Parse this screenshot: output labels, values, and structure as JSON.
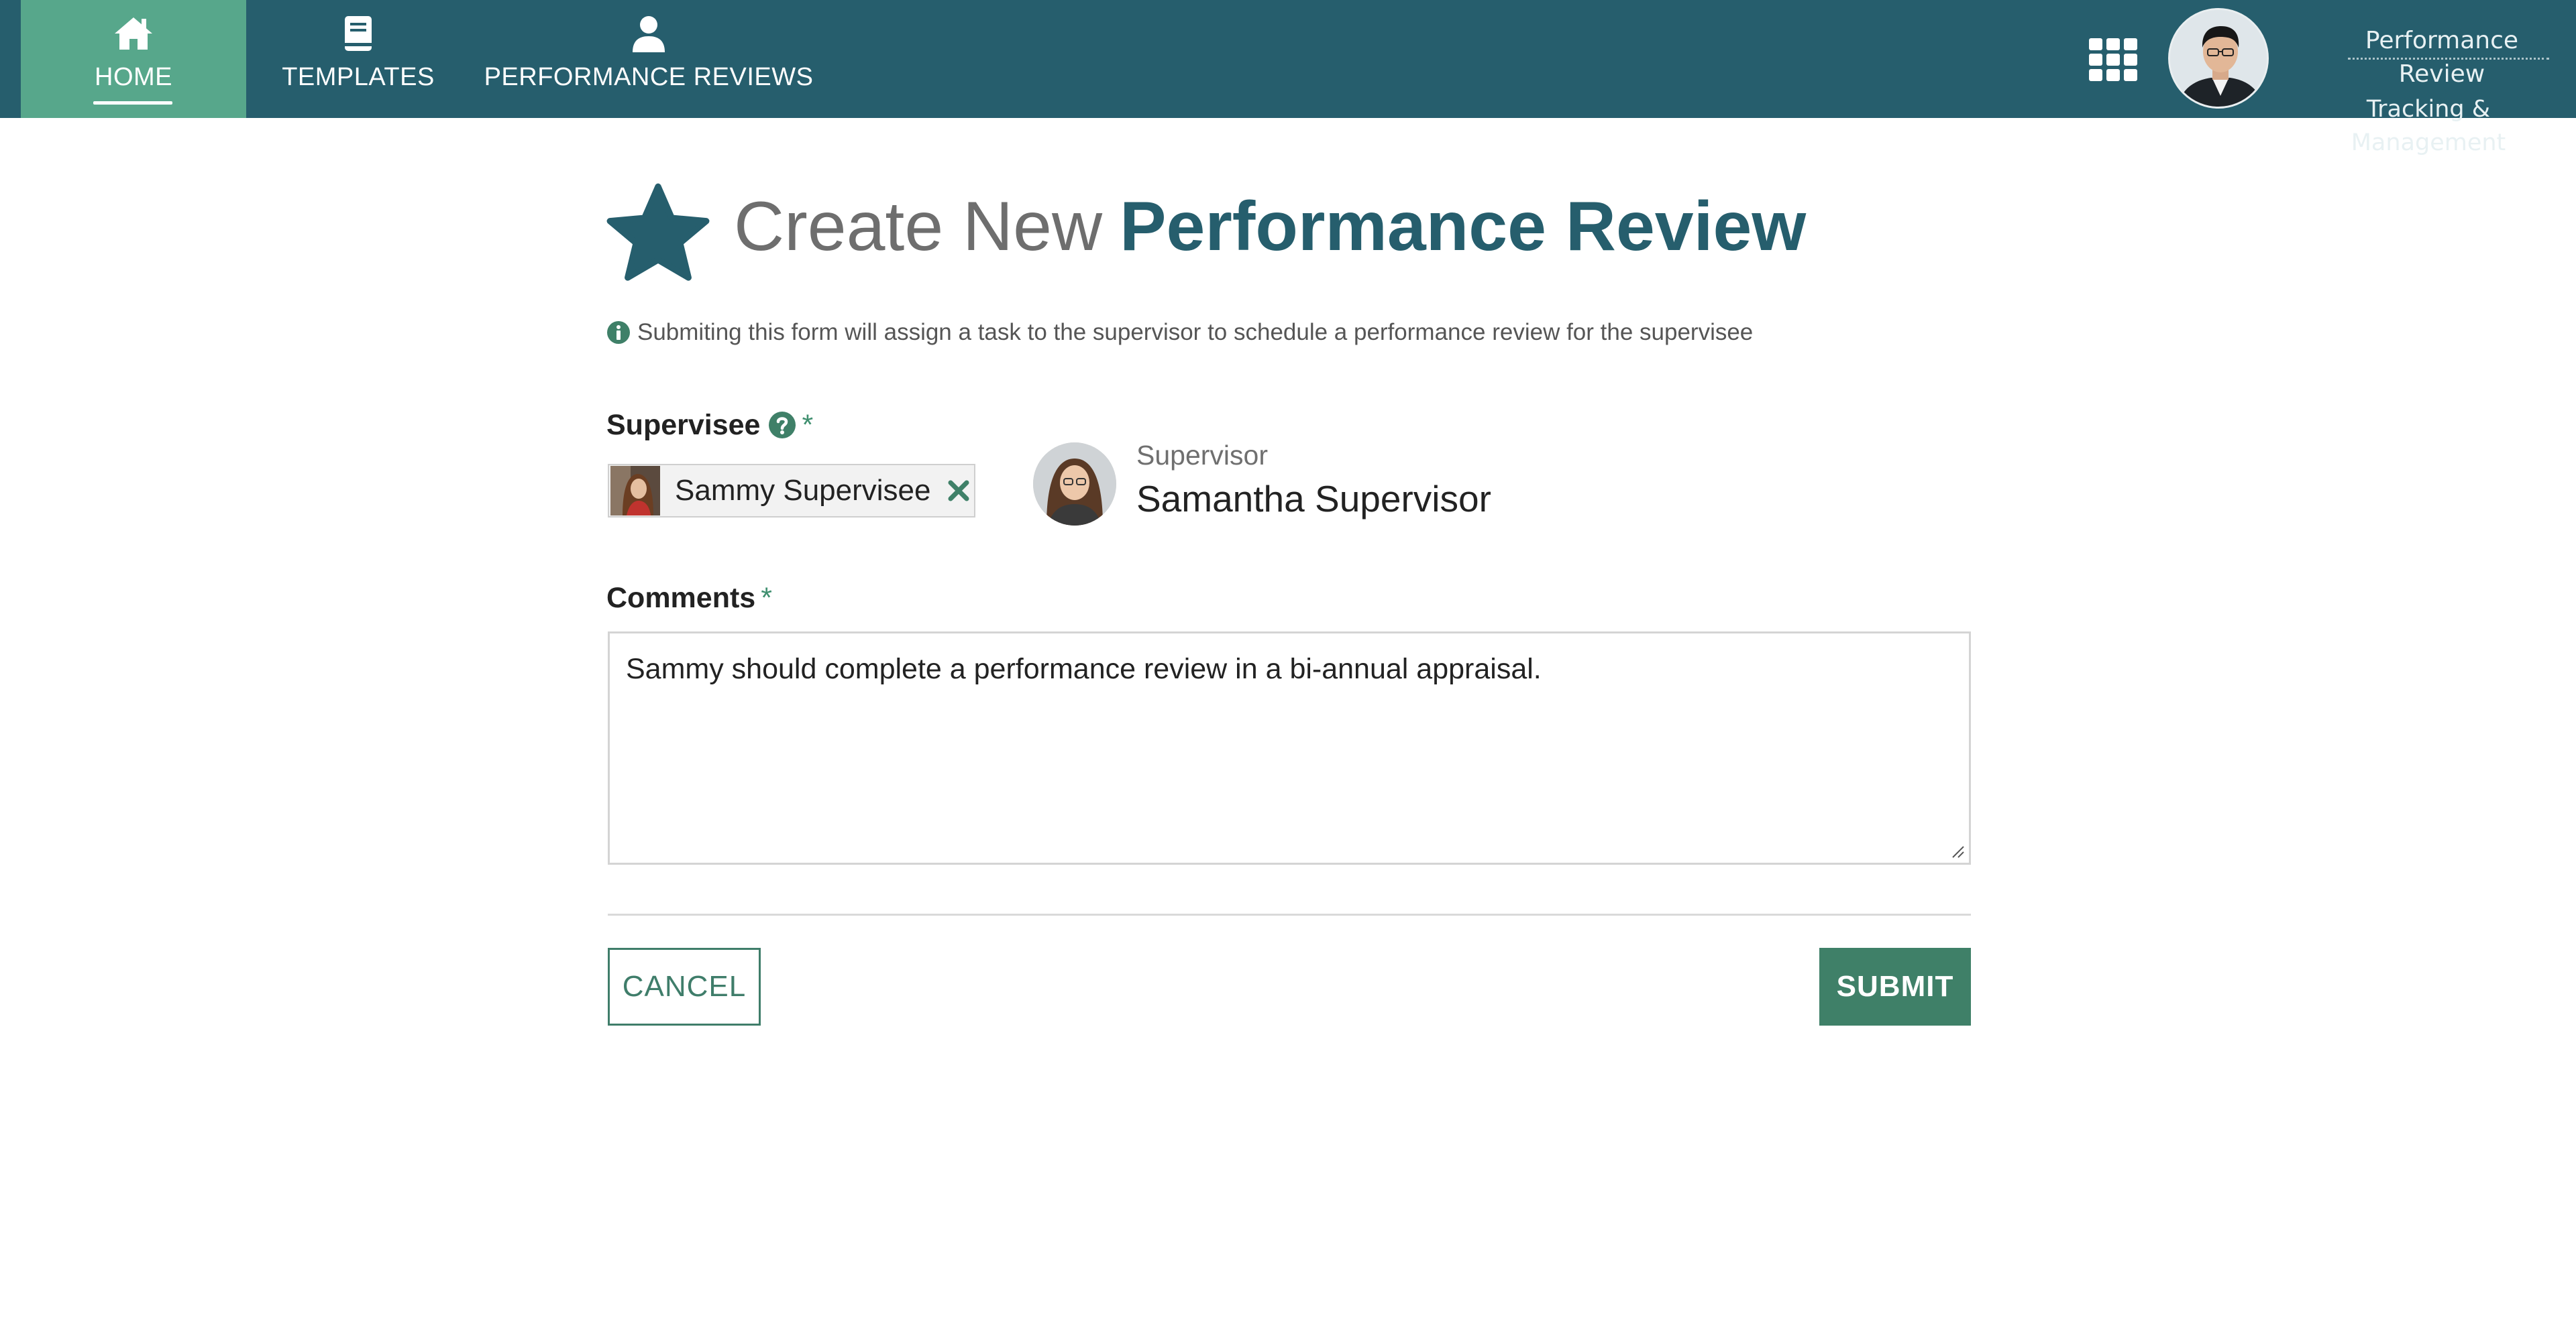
{
  "nav": {
    "items": [
      {
        "label": "HOME",
        "icon": "home-icon",
        "active": true
      },
      {
        "label": "TEMPLATES",
        "icon": "book-icon",
        "active": false
      },
      {
        "label": "PERFORMANCE REVIEWS",
        "icon": "user-icon",
        "active": false
      }
    ],
    "apps_icon": "grid-icon",
    "brand": {
      "line1": "Performance Review",
      "line2": "Tracking & Management"
    }
  },
  "page": {
    "title_light": "Create New",
    "title_bold": "Performance Review",
    "title_icon": "star-icon",
    "info_text": "Submiting this form will assign a task to the supervisor to schedule a performance review for the supervisee"
  },
  "form": {
    "supervisee": {
      "label": "Supervisee",
      "required_mark": "*",
      "selected_name": "Sammy Supervisee"
    },
    "supervisor": {
      "caption": "Supervisor",
      "name": "Samantha Supervisor"
    },
    "comments": {
      "label": "Comments",
      "required_mark": "*",
      "value": "Sammy should complete a performance review in a bi-annual appraisal."
    },
    "cancel_label": "CANCEL",
    "submit_label": "SUBMIT"
  },
  "colors": {
    "header": "#265e6d",
    "active_nav": "#57a78b",
    "accent_green": "#3f8068",
    "title_teal": "#265e6d"
  }
}
